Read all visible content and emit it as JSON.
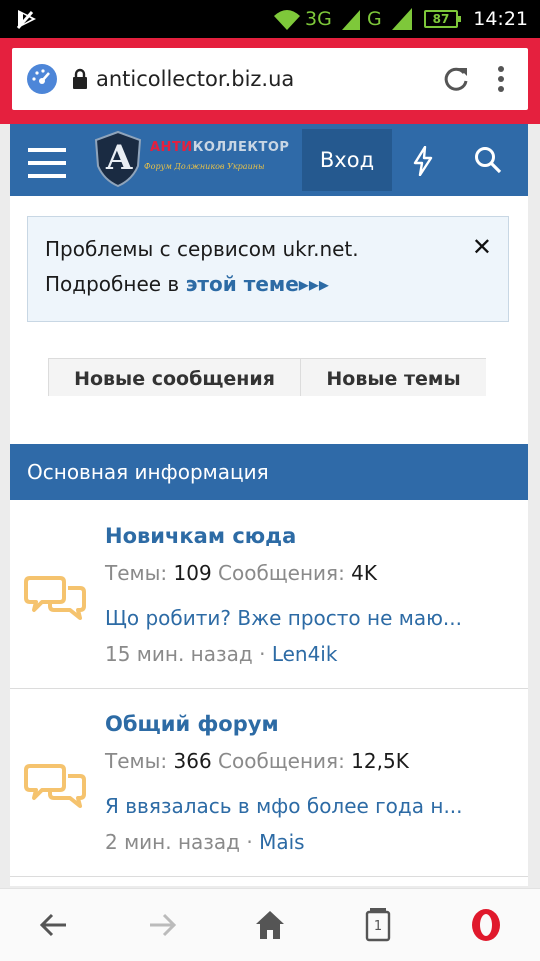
{
  "status_bar": {
    "network_1": "3G",
    "network_2": "G",
    "battery": "87",
    "time": "14:21"
  },
  "browser": {
    "url": "anticollector.biz.ua"
  },
  "header": {
    "logo_text_red": "АНТИ",
    "logo_text_white": "КОЛЛЕКТОР",
    "logo_subtitle": "Форум Должников Украины",
    "logo_letter": "A",
    "login_label": "Вход"
  },
  "notice": {
    "line1": "Проблемы с сервисом ukr.net.",
    "line2_prefix": "Подробнее в ",
    "link": "этой теме▸▸▸",
    "close": "✕"
  },
  "tabs": [
    {
      "label": "Новые сообщения"
    },
    {
      "label": "Новые темы"
    }
  ],
  "section": {
    "title": "Основная информация"
  },
  "forums": [
    {
      "title": "Новичкам сюда",
      "topics_label": "Темы:",
      "topics": "109",
      "posts_label": "Сообщения:",
      "posts": "4K",
      "last_thread": "Що робити? Вже просто не маю...",
      "time": "15 мин. назад",
      "separator": " · ",
      "user": "Len4ik"
    },
    {
      "title": "Общий форум",
      "topics_label": "Темы:",
      "topics": "366",
      "posts_label": "Сообщения:",
      "posts": "12,5K",
      "last_thread": "Я ввязалась в мфо более года н...",
      "time": "2 мин. назад",
      "separator": " · ",
      "user": "Mais"
    }
  ],
  "bottom_nav": {
    "tabs_count": "1"
  },
  "colors": {
    "accent_blue": "#2f6aa8",
    "link_blue": "#2d6ba5",
    "browser_red": "#e5203e",
    "opera_red": "#e0192c",
    "forum_icon": "#f5c36e"
  }
}
